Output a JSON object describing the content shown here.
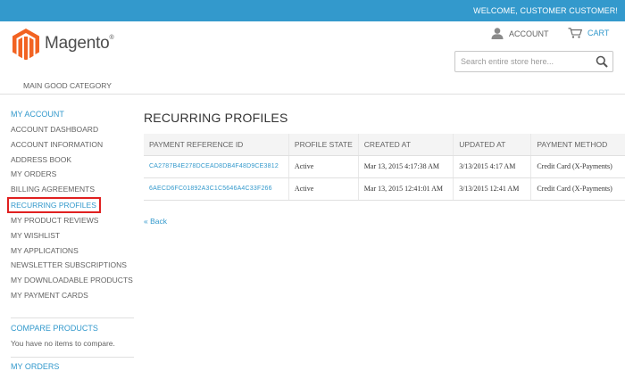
{
  "header": {
    "welcome": "WELCOME, CUSTOMER CUSTOMER!",
    "logo_text": "Magento",
    "logo_mark": "®",
    "account_label": "ACCOUNT",
    "cart_label": "CART",
    "search_placeholder": "Search entire store here...",
    "brand_color": "#3399cc",
    "logo_color": "#f26322"
  },
  "nav": {
    "category": "MAIN GOOD CATEGORY"
  },
  "sidebar": {
    "title": "MY ACCOUNT",
    "items": [
      {
        "label": "ACCOUNT DASHBOARD"
      },
      {
        "label": "ACCOUNT INFORMATION"
      },
      {
        "label": "ADDRESS BOOK"
      },
      {
        "label": "MY ORDERS"
      },
      {
        "label": "BILLING AGREEMENTS"
      },
      {
        "label": "RECURRING PROFILES",
        "active": true
      },
      {
        "label": "MY PRODUCT REVIEWS"
      },
      {
        "label": "MY WISHLIST"
      },
      {
        "label": "MY APPLICATIONS"
      },
      {
        "label": "NEWSLETTER SUBSCRIPTIONS"
      },
      {
        "label": "MY DOWNLOADABLE PRODUCTS"
      },
      {
        "label": "MY PAYMENT CARDS"
      }
    ],
    "compare_title": "COMPARE PRODUCTS",
    "compare_text": "You have no items to compare.",
    "orders_title": "MY ORDERS"
  },
  "main": {
    "title": "RECURRING PROFILES",
    "columns": [
      "PAYMENT REFERENCE ID",
      "PROFILE STATE",
      "CREATED AT",
      "UPDATED AT",
      "PAYMENT METHOD"
    ],
    "rows": [
      [
        "CA2787B4E278DCEAD8DB4F48D9CE3812",
        "Active",
        "Mar 13, 2015 4:17:38 AM",
        "3/13/2015 4:17 AM",
        "Credit Card (X-Payments)"
      ],
      [
        "6AECD6FC01892A3C1C5646A4C33F266",
        "Active",
        "Mar 13, 2015 12:41:01 AM",
        "3/13/2015 12:41 AM",
        "Credit Card (X-Payments)"
      ]
    ],
    "back_link": "« Back"
  }
}
